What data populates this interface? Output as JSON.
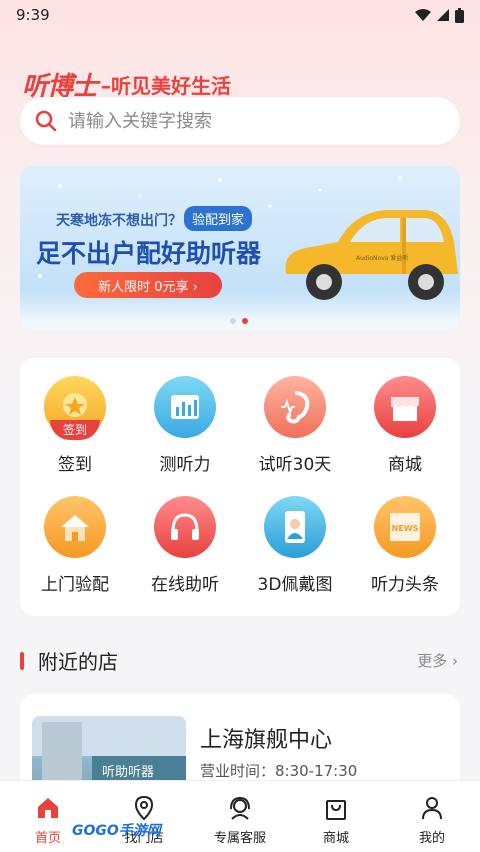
{
  "status_bar": {
    "time": "9:39"
  },
  "brand": {
    "logo": "听博士",
    "slogan": "–听见美好生活"
  },
  "search": {
    "placeholder": "请输入关键字搜索"
  },
  "banner": {
    "subtitle": "天寒地冻不想出门？",
    "tag": "验配到家",
    "title": "足不出户配好助听器",
    "cta": "新人限时 0元享 ›",
    "car_text": "AudioNova 爱益听"
  },
  "features": [
    {
      "label": "签到",
      "badge": "签到"
    },
    {
      "label": "测听力"
    },
    {
      "label": "试听30天"
    },
    {
      "label": "商城"
    },
    {
      "label": "上门验配"
    },
    {
      "label": "在线助听"
    },
    {
      "label": "3D佩戴图"
    },
    {
      "label": "听力头条",
      "badge": "NEWS"
    }
  ],
  "nearby": {
    "title": "附近的店",
    "more": "更多 ›",
    "store": {
      "name": "上海旗舰中心",
      "hours": "营业时间：8:30-17:30",
      "sign": "听助听器"
    }
  },
  "tabbar": [
    {
      "label": "首页",
      "active": true
    },
    {
      "label": "找门店"
    },
    {
      "label": "专属客服"
    },
    {
      "label": "商城"
    },
    {
      "label": "我的"
    }
  ],
  "watermark": "GOGO手游网",
  "colors": {
    "accent": "#e8413e",
    "banner_blue": "#1f4fb0"
  }
}
